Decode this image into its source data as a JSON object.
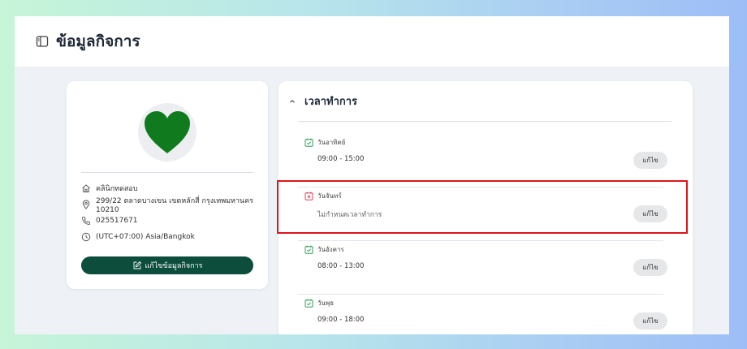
{
  "page": {
    "title": "ข้อมูลกิจการ"
  },
  "profile": {
    "name": "คลินิกทดสอบ",
    "address": "299/22 ตลาดบางเขน เขตหลักสี่ กรุงเทพมหานคร 10210",
    "phone": "025517671",
    "timezone": "(UTC+07:00) Asia/Bangkok",
    "edit_label": "แก้ไขข้อมูลกิจการ"
  },
  "hours": {
    "title": "เวลาทำการ",
    "days": [
      {
        "name": "วันอาทิตย์",
        "time": "09:00 - 15:00",
        "status": "open",
        "edit_label": "แก้ไข"
      },
      {
        "name": "วันจันทร์",
        "time": "ไม่กำหนดเวลาทำการ",
        "status": "closed",
        "edit_label": "แก้ไข"
      },
      {
        "name": "วันอังคาร",
        "time": "08:00 - 13:00",
        "status": "open",
        "edit_label": "แก้ไข"
      },
      {
        "name": "วันพุธ",
        "time": "09:00 - 18:00",
        "status": "open",
        "edit_label": "แก้ไข"
      }
    ]
  },
  "colors": {
    "primary_button": "#0d4d3c",
    "open_icon": "#2e9e5b",
    "closed_icon": "#e0405a",
    "highlight": "#e0141c",
    "heart": "#0f7a1e"
  },
  "icons": {
    "title": "sidebar-panel-icon",
    "name": "house-icon",
    "address": "location-pin-icon",
    "phone": "phone-icon",
    "timezone": "clock-icon",
    "edit": "edit-pencil-icon",
    "collapse": "chevron-up-icon",
    "open_day": "calendar-check-icon",
    "closed_day": "calendar-x-icon"
  }
}
